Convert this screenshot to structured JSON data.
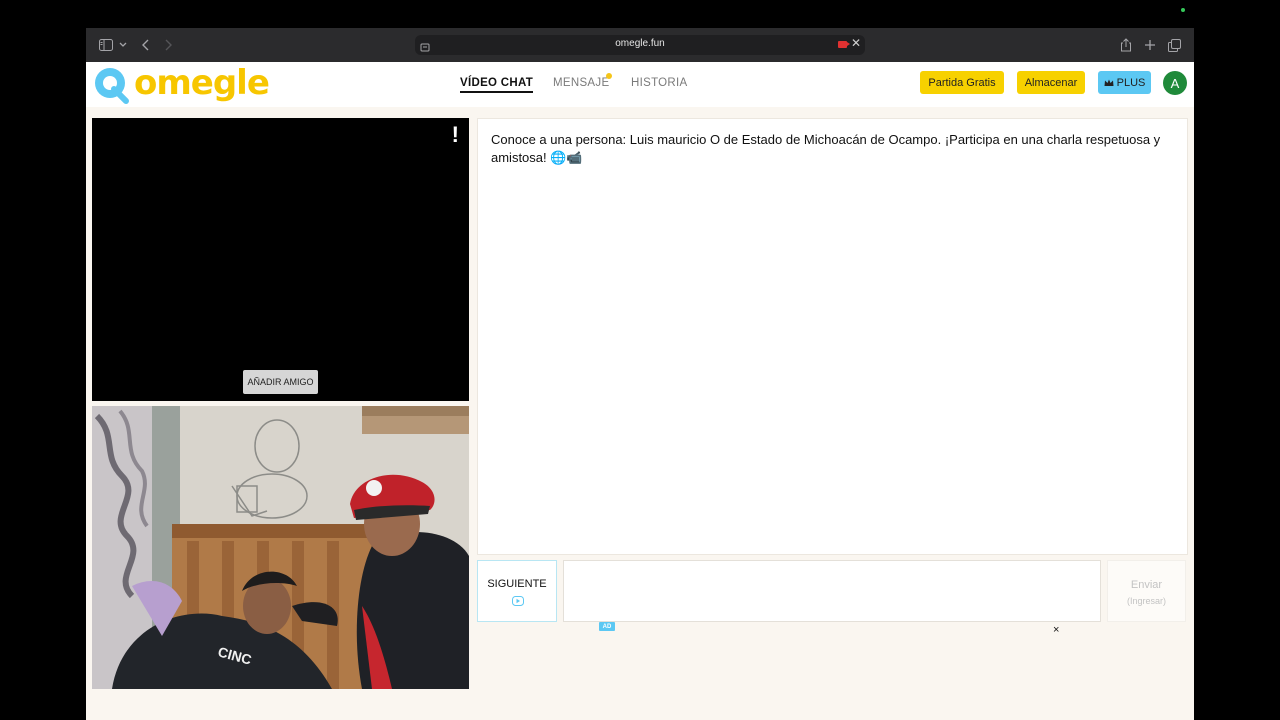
{
  "browser": {
    "url": "omegle.fun"
  },
  "header": {
    "logo_text": "omegle",
    "nav": {
      "video_chat": "VÍDEO CHAT",
      "message": "MENSAJE",
      "history": "HISTORIA"
    },
    "buttons": {
      "free_game": "Partida Gratis",
      "store": "Almacenar",
      "plus": "PLUS"
    },
    "avatar_letter": "A"
  },
  "video": {
    "alert_glyph": "!",
    "add_friend": "AÑADIR AMIGO"
  },
  "chat": {
    "message": "Conoce a una persona: Luis mauricio O de Estado de Michoacán de Ocampo. ¡Participa en una charla respetuosa y amistosa! 🌐📹"
  },
  "controls": {
    "next_label": "SIGUIENTE",
    "send_label": "Enviar",
    "send_hint": "(Ingresar)",
    "ad_badge": "AD",
    "ad_close": "×"
  },
  "colors": {
    "brand_yellow": "#f7c600",
    "accent_blue": "#5cc8f3",
    "avatar_green": "#1f8a3a"
  }
}
